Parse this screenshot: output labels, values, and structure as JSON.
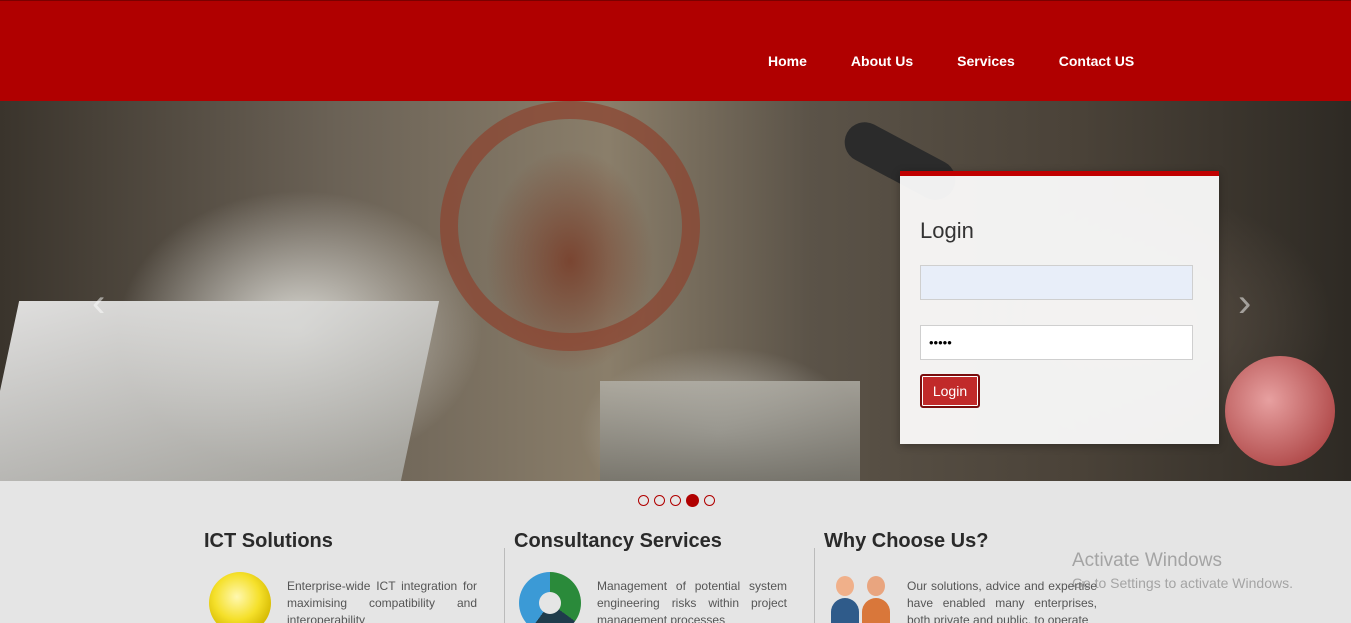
{
  "nav": {
    "items": [
      "Home",
      "About Us",
      "Services",
      "Contact US"
    ]
  },
  "login": {
    "title": "Login",
    "username_value": "",
    "password_value": "•••••",
    "button_label": "Login"
  },
  "slider": {
    "dots": 5,
    "active_index": 3
  },
  "sections": [
    {
      "title": "ICT Solutions",
      "icon": "lightbulb-icon",
      "text": "Enterprise-wide ICT integration for maximising compatibility and interoperability"
    },
    {
      "title": "Consultancy Services",
      "icon": "cycle-arrows-icon",
      "text": "Management of potential system engineering risks within project management processes"
    },
    {
      "title": "Why Choose Us?",
      "icon": "people-icon",
      "text": "Our solutions, advice and expertise have enabled many enterprises, both private and public, to operate"
    }
  ],
  "watermark": {
    "line1": "Activate Windows",
    "line2": "Go to Settings to activate Windows."
  },
  "colors": {
    "brand_red": "#b00000",
    "button_red": "#c12a2a"
  }
}
